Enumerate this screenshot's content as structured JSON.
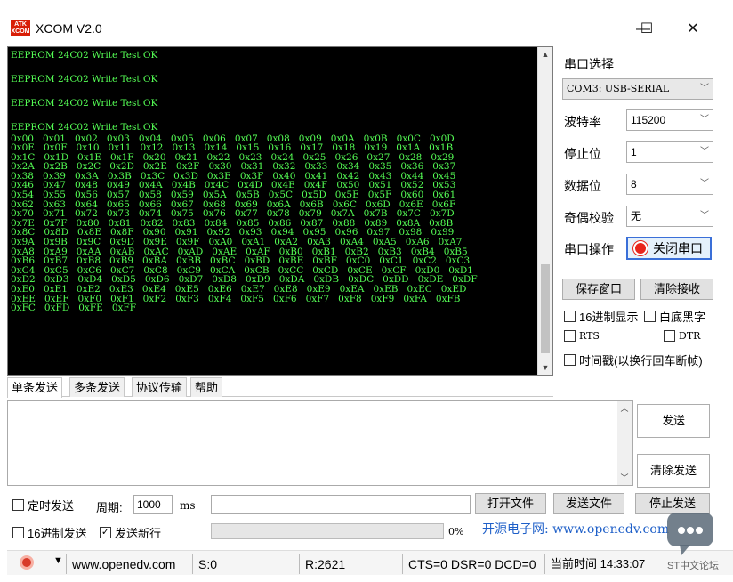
{
  "window": {
    "logo_text": "ATK XCOM",
    "title": "XCOM V2.0",
    "minimize": "—",
    "maximize": "☐",
    "close": "✕"
  },
  "receive": {
    "lines": [
      "EEPROM 24C02 Write Test OK",
      "",
      "EEPROM 24C02 Write Test OK",
      "",
      "EEPROM 24C02 Write Test OK",
      "",
      "EEPROM 24C02 Write Test OK",
      "0x00   0x01   0x02   0x03   0x04   0x05   0x06   0x07   0x08   0x09   0x0A   0x0B   0x0C   0x0D",
      "0x0E   0x0F   0x10   0x11   0x12   0x13   0x14   0x15   0x16   0x17   0x18   0x19   0x1A   0x1B",
      "0x1C   0x1D   0x1E   0x1F   0x20   0x21   0x22   0x23   0x24   0x25   0x26   0x27   0x28   0x29",
      "0x2A   0x2B   0x2C   0x2D   0x2E   0x2F   0x30   0x31   0x32   0x33   0x34   0x35   0x36   0x37",
      "0x38   0x39   0x3A   0x3B   0x3C   0x3D   0x3E   0x3F   0x40   0x41   0x42   0x43   0x44   0x45",
      "0x46   0x47   0x48   0x49   0x4A   0x4B   0x4C   0x4D   0x4E   0x4F   0x50   0x51   0x52   0x53",
      "0x54   0x55   0x56   0x57   0x58   0x59   0x5A   0x5B   0x5C   0x5D   0x5E   0x5F   0x60   0x61",
      "0x62   0x63   0x64   0x65   0x66   0x67   0x68   0x69   0x6A   0x6B   0x6C   0x6D   0x6E   0x6F",
      "0x70   0x71   0x72   0x73   0x74   0x75   0x76   0x77   0x78   0x79   0x7A   0x7B   0x7C   0x7D",
      "0x7E   0x7F   0x80   0x81   0x82   0x83   0x84   0x85   0x86   0x87   0x88   0x89   0x8A   0x8B",
      "0x8C   0x8D   0x8E   0x8F   0x90   0x91   0x92   0x93   0x94   0x95   0x96   0x97   0x98   0x99",
      "0x9A   0x9B   0x9C   0x9D   0x9E   0x9F   0xA0   0xA1   0xA2   0xA3   0xA4   0xA5   0xA6   0xA7",
      "0xA8   0xA9   0xAA   0xAB   0xAC   0xAD   0xAE   0xAF   0xB0   0xB1   0xB2   0xB3   0xB4   0xB5",
      "0xB6   0xB7   0xB8   0xB9   0xBA   0xBB   0xBC   0xBD   0xBE   0xBF   0xC0   0xC1   0xC2   0xC3",
      "0xC4   0xC5   0xC6   0xC7   0xC8   0xC9   0xCA   0xCB   0xCC   0xCD   0xCE   0xCF   0xD0   0xD1",
      "0xD2   0xD3   0xD4   0xD5   0xD6   0xD7   0xD8   0xD9   0xDA   0xDB   0xDC   0xDD   0xDE   0xDF",
      "0xE0   0xE1   0xE2   0xE3   0xE4   0xE5   0xE6   0xE7   0xE8   0xE9   0xEA   0xEB   0xEC   0xED",
      "0xEE   0xEF   0xF0   0xF1   0xF2   0xF3   0xF4   0xF5   0xF6   0xF7   0xF8   0xF9   0xFA   0xFB",
      "0xFC   0xFD   0xFE   0xFF"
    ]
  },
  "settings": {
    "port_label": "串口选择",
    "port_value": "COM3: USB-SERIAL",
    "baud_label": "波特率",
    "baud_value": "115200",
    "stop_label": "停止位",
    "stop_value": "1",
    "data_label": "数据位",
    "data_value": "8",
    "parity_label": "奇偶校验",
    "parity_value": "无",
    "op_label": "串口操作",
    "op_button": "关闭串口",
    "save_window": "保存窗口",
    "clear_receive": "清除接收",
    "hex_display": "16进制显示",
    "white_black": "白底黑字",
    "rts": "RTS",
    "dtr": "DTR",
    "timestamp": "时间戳(以换行回车断帧)"
  },
  "tabs": [
    "单条发送",
    "多条发送",
    "协议传输",
    "帮助"
  ],
  "send": {
    "send_button": "发送",
    "clear_send": "清除发送",
    "timed_send": "定时发送",
    "period_label": "周期:",
    "period_value": "1000",
    "period_unit": "ms",
    "hex_send": "16进制发送",
    "new_line": "发送新行",
    "new_line_checked": "✓",
    "open_file": "打开文件",
    "send_file": "发送文件",
    "stop_send": "停止发送",
    "progress": "0%",
    "promo": "开源电子网: www.openedv.com"
  },
  "status": {
    "url": "www.openedv.com",
    "sent": "S:0",
    "received": "R:2621",
    "lines": "CTS=0 DSR=0 DCD=0",
    "time": "当前时间 14:33:07",
    "watermark": "ST中文论坛"
  }
}
